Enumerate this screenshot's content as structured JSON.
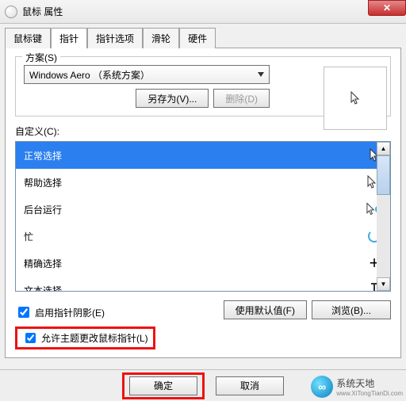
{
  "window": {
    "title": "鼠标 属性"
  },
  "tabs": {
    "items": [
      {
        "label": "鼠标键",
        "active": false
      },
      {
        "label": "指针",
        "active": true
      },
      {
        "label": "指针选项",
        "active": false
      },
      {
        "label": "滑轮",
        "active": false
      },
      {
        "label": "硬件",
        "active": false
      }
    ]
  },
  "scheme": {
    "legend": "方案(S)",
    "selected": "Windows Aero （系统方案）",
    "save_as_label": "另存为(V)...",
    "delete_label": "删除(D)"
  },
  "customize": {
    "label": "自定义(C):",
    "items": [
      {
        "label": "正常选择",
        "icon": "arrow",
        "selected": true
      },
      {
        "label": "帮助选择",
        "icon": "arrow-help",
        "selected": false
      },
      {
        "label": "后台运行",
        "icon": "arrow-spinner",
        "selected": false
      },
      {
        "label": "忙",
        "icon": "spinner",
        "selected": false
      },
      {
        "label": "精确选择",
        "icon": "cross",
        "selected": false
      },
      {
        "label": "文本选择",
        "icon": "ibeam",
        "selected": false
      }
    ]
  },
  "checkboxes": {
    "shadow": {
      "label": "启用指针阴影(E)",
      "checked": true
    },
    "theme": {
      "label": "允许主题更改鼠标指针(L)",
      "checked": true
    }
  },
  "buttons": {
    "use_default": "使用默认值(F)",
    "browse": "浏览(B)...",
    "ok": "确定",
    "cancel": "取消"
  },
  "watermark": {
    "name": "系统天地",
    "url": "www.XiTongTianDi.com"
  }
}
